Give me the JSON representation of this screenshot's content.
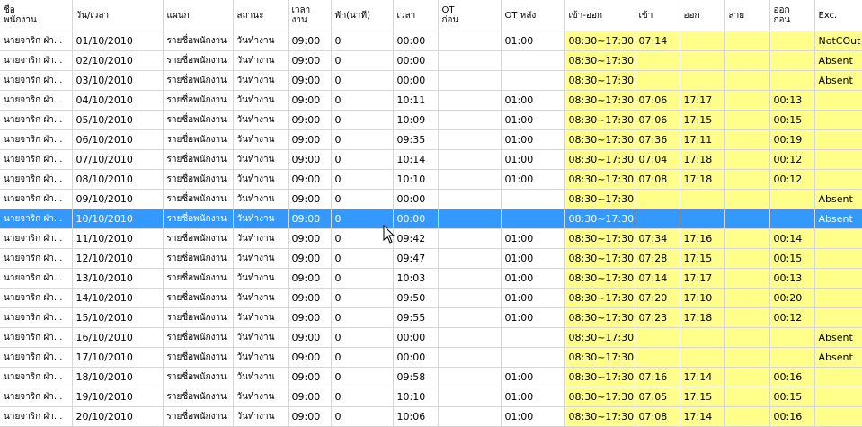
{
  "columns": [
    "ชื่อ\nพนักงาน",
    "วัน/เวลา",
    "แผนก",
    "สถานะ",
    "เวลา\nงาน",
    "พัก(นาที)",
    "เวลา",
    "OT\nก่อน",
    "OT หลัง",
    "เข้า-ออก",
    "เข้า",
    "ออก",
    "สาย",
    "ออก\nก่อน",
    "Exc."
  ],
  "rows": [
    {
      "name": "นายจาริก ฝ่า...",
      "date": "01/10/2010",
      "dept": "รายชื่อพนักงาน",
      "status": "วันทำงาน",
      "work": "09:00",
      "brk": "0",
      "time": "00:00",
      "ot_before": "",
      "ot_after": "01:00",
      "shift": "08:30~17:30",
      "in": "07:14",
      "out": "",
      "late": "",
      "early": "",
      "exc": "NotCOut"
    },
    {
      "name": "นายจาริก ฝ่า...",
      "date": "02/10/2010",
      "dept": "รายชื่อพนักงาน",
      "status": "วันทำงาน",
      "work": "09:00",
      "brk": "0",
      "time": "00:00",
      "ot_before": "",
      "ot_after": "",
      "shift": "08:30~17:30",
      "in": "",
      "out": "",
      "late": "",
      "early": "",
      "exc": "Absent"
    },
    {
      "name": "นายจาริก ฝ่า...",
      "date": "03/10/2010",
      "dept": "รายชื่อพนักงาน",
      "status": "วันทำงาน",
      "work": "09:00",
      "brk": "0",
      "time": "00:00",
      "ot_before": "",
      "ot_after": "",
      "shift": "08:30~17:30",
      "in": "",
      "out": "",
      "late": "",
      "early": "",
      "exc": "Absent"
    },
    {
      "name": "นายจาริก ฝ่า...",
      "date": "04/10/2010",
      "dept": "รายชื่อพนักงาน",
      "status": "วันทำงาน",
      "work": "09:00",
      "brk": "0",
      "time": "10:11",
      "ot_before": "",
      "ot_after": "01:00",
      "shift": "08:30~17:30",
      "in": "07:06",
      "out": "17:17",
      "late": "",
      "early": "00:13",
      "exc": ""
    },
    {
      "name": "นายจาริก ฝ่า...",
      "date": "05/10/2010",
      "dept": "รายชื่อพนักงาน",
      "status": "วันทำงาน",
      "work": "09:00",
      "brk": "0",
      "time": "10:09",
      "ot_before": "",
      "ot_after": "01:00",
      "shift": "08:30~17:30",
      "in": "07:06",
      "out": "17:15",
      "late": "",
      "early": "00:15",
      "exc": ""
    },
    {
      "name": "นายจาริก ฝ่า...",
      "date": "06/10/2010",
      "dept": "รายชื่อพนักงาน",
      "status": "วันทำงาน",
      "work": "09:00",
      "brk": "0",
      "time": "09:35",
      "ot_before": "",
      "ot_after": "01:00",
      "shift": "08:30~17:30",
      "in": "07:36",
      "out": "17:11",
      "late": "",
      "early": "00:19",
      "exc": ""
    },
    {
      "name": "นายจาริก ฝ่า...",
      "date": "07/10/2010",
      "dept": "รายชื่อพนักงาน",
      "status": "วันทำงาน",
      "work": "09:00",
      "brk": "0",
      "time": "10:14",
      "ot_before": "",
      "ot_after": "01:00",
      "shift": "08:30~17:30",
      "in": "07:04",
      "out": "17:18",
      "late": "",
      "early": "00:12",
      "exc": ""
    },
    {
      "name": "นายจาริก ฝ่า...",
      "date": "08/10/2010",
      "dept": "รายชื่อพนักงาน",
      "status": "วันทำงาน",
      "work": "09:00",
      "brk": "0",
      "time": "10:10",
      "ot_before": "",
      "ot_after": "01:00",
      "shift": "08:30~17:30",
      "in": "07:08",
      "out": "17:18",
      "late": "",
      "early": "00:12",
      "exc": ""
    },
    {
      "name": "นายจาริก ฝ่า...",
      "date": "09/10/2010",
      "dept": "รายชื่อพนักงาน",
      "status": "วันทำงาน",
      "work": "09:00",
      "brk": "0",
      "time": "00:00",
      "ot_before": "",
      "ot_after": "",
      "shift": "08:30~17:30",
      "in": "",
      "out": "",
      "late": "",
      "early": "",
      "exc": "Absent"
    },
    {
      "name": "นายจาริก ฝ่า...",
      "date": "10/10/2010",
      "dept": "รายชื่อพนักงาน",
      "status": "วันทำงาน",
      "work": "09:00",
      "brk": "0",
      "time": "00:00",
      "ot_before": "",
      "ot_after": "",
      "shift": "08:30~17:30",
      "in": "",
      "out": "",
      "late": "",
      "early": "",
      "exc": "Absent",
      "selected": true
    },
    {
      "name": "นายจาริก ฝ่า...",
      "date": "11/10/2010",
      "dept": "รายชื่อพนักงาน",
      "status": "วันทำงาน",
      "work": "09:00",
      "brk": "0",
      "time": "09:42",
      "ot_before": "",
      "ot_after": "01:00",
      "shift": "08:30~17:30",
      "in": "07:34",
      "out": "17:16",
      "late": "",
      "early": "00:14",
      "exc": ""
    },
    {
      "name": "นายจาริก ฝ่า...",
      "date": "12/10/2010",
      "dept": "รายชื่อพนักงาน",
      "status": "วันทำงาน",
      "work": "09:00",
      "brk": "0",
      "time": "09:47",
      "ot_before": "",
      "ot_after": "01:00",
      "shift": "08:30~17:30",
      "in": "07:28",
      "out": "17:15",
      "late": "",
      "early": "00:15",
      "exc": ""
    },
    {
      "name": "นายจาริก ฝ่า...",
      "date": "13/10/2010",
      "dept": "รายชื่อพนักงาน",
      "status": "วันทำงาน",
      "work": "09:00",
      "brk": "0",
      "time": "10:03",
      "ot_before": "",
      "ot_after": "01:00",
      "shift": "08:30~17:30",
      "in": "07:14",
      "out": "17:17",
      "late": "",
      "early": "00:13",
      "exc": ""
    },
    {
      "name": "นายจาริก ฝ่า...",
      "date": "14/10/2010",
      "dept": "รายชื่อพนักงาน",
      "status": "วันทำงาน",
      "work": "09:00",
      "brk": "0",
      "time": "09:50",
      "ot_before": "",
      "ot_after": "01:00",
      "shift": "08:30~17:30",
      "in": "07:20",
      "out": "17:10",
      "late": "",
      "early": "00:20",
      "exc": ""
    },
    {
      "name": "นายจาริก ฝ่า...",
      "date": "15/10/2010",
      "dept": "รายชื่อพนักงาน",
      "status": "วันทำงาน",
      "work": "09:00",
      "brk": "0",
      "time": "09:55",
      "ot_before": "",
      "ot_after": "01:00",
      "shift": "08:30~17:30",
      "in": "07:23",
      "out": "17:18",
      "late": "",
      "early": "00:12",
      "exc": ""
    },
    {
      "name": "นายจาริก ฝ่า...",
      "date": "16/10/2010",
      "dept": "รายชื่อพนักงาน",
      "status": "วันทำงาน",
      "work": "09:00",
      "brk": "0",
      "time": "00:00",
      "ot_before": "",
      "ot_after": "",
      "shift": "08:30~17:30",
      "in": "",
      "out": "",
      "late": "",
      "early": "",
      "exc": "Absent"
    },
    {
      "name": "นายจาริก ฝ่า...",
      "date": "17/10/2010",
      "dept": "รายชื่อพนักงาน",
      "status": "วันทำงาน",
      "work": "09:00",
      "brk": "0",
      "time": "00:00",
      "ot_before": "",
      "ot_after": "",
      "shift": "08:30~17:30",
      "in": "",
      "out": "",
      "late": "",
      "early": "",
      "exc": "Absent"
    },
    {
      "name": "นายจาริก ฝ่า...",
      "date": "18/10/2010",
      "dept": "รายชื่อพนักงาน",
      "status": "วันทำงาน",
      "work": "09:00",
      "brk": "0",
      "time": "09:58",
      "ot_before": "",
      "ot_after": "01:00",
      "shift": "08:30~17:30",
      "in": "07:16",
      "out": "17:14",
      "late": "",
      "early": "00:16",
      "exc": ""
    },
    {
      "name": "นายจาริก ฝ่า...",
      "date": "19/10/2010",
      "dept": "รายชื่อพนักงาน",
      "status": "วันทำงาน",
      "work": "09:00",
      "brk": "0",
      "time": "10:10",
      "ot_before": "",
      "ot_after": "01:00",
      "shift": "08:30~17:30",
      "in": "07:05",
      "out": "17:15",
      "late": "",
      "early": "00:15",
      "exc": ""
    },
    {
      "name": "นายจาริก ฝ่า...",
      "date": "20/10/2010",
      "dept": "รายชื่อพนักงาน",
      "status": "วันทำงาน",
      "work": "09:00",
      "brk": "0",
      "time": "10:06",
      "ot_before": "",
      "ot_after": "01:00",
      "shift": "08:30~17:30",
      "in": "07:08",
      "out": "17:14",
      "late": "",
      "early": "00:16",
      "exc": ""
    }
  ],
  "colors": {
    "highlight": "#ffff8a",
    "selected": "#3399ff",
    "gridline": "#d6d6d6"
  }
}
